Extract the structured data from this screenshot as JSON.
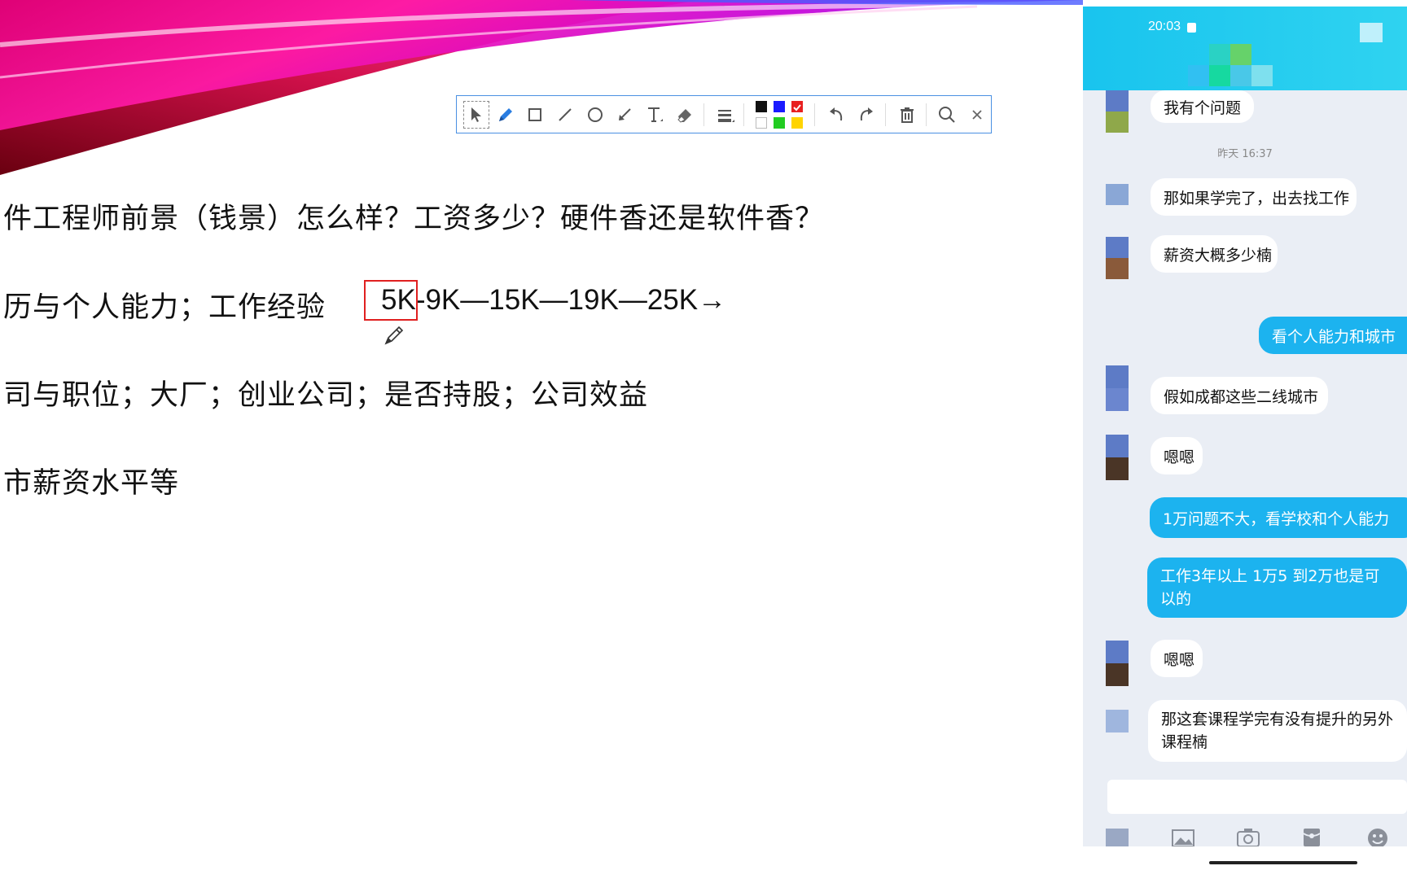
{
  "slide": {
    "line1": "件工程师前景（钱景）怎么样？工资多少？硬件香还是软件香？",
    "line2": "历与个人能力；工作经验",
    "salary_first": "5K",
    "salary_rest": "-9K—15K—19K—25K",
    "salary_arrow": "→",
    "line3": "司与职位；大厂；创业公司；是否持股；公司效益",
    "line4": "市薪资水平等"
  },
  "toolbar": {
    "tools": [
      "select-icon",
      "pen-icon",
      "rectangle-icon",
      "line-icon",
      "ellipse-icon",
      "arrow-icon",
      "text-icon",
      "eraser-icon",
      "line-width-icon"
    ],
    "colors": [
      "#111111",
      "#1a1aff",
      "#e82020",
      "#ffffff",
      "#22cc22",
      "#ffd400"
    ],
    "selected_color": "#e82020",
    "actions": [
      "undo-icon",
      "redo-icon",
      "delete-icon",
      "zoom-icon",
      "close-icon"
    ]
  },
  "phone": {
    "time": "20:03",
    "header_color": "#19c4ee",
    "timestamp": "昨天 16:37",
    "messages": [
      {
        "from": "them",
        "text": "我有个问题"
      },
      {
        "from": "them",
        "text": "那如果学完了，出去找工作"
      },
      {
        "from": "them",
        "text": "薪资大概多少楠"
      },
      {
        "from": "me",
        "text": "看个人能力和城市"
      },
      {
        "from": "them",
        "text": "假如成都这些二线城市"
      },
      {
        "from": "them",
        "text": "嗯嗯"
      },
      {
        "from": "me",
        "text": "1万问题不大，看学校和个人能力"
      },
      {
        "from": "me",
        "text": "工作3年以上 1万5 到2万也是可以的"
      },
      {
        "from": "them",
        "text": "嗯嗯"
      },
      {
        "from": "them",
        "text": "那这套课程学完有没有提升的另外课程楠"
      }
    ],
    "bottom_icons": [
      "image-icon",
      "camera-icon",
      "red-packet-icon",
      "emoji-icon"
    ]
  }
}
